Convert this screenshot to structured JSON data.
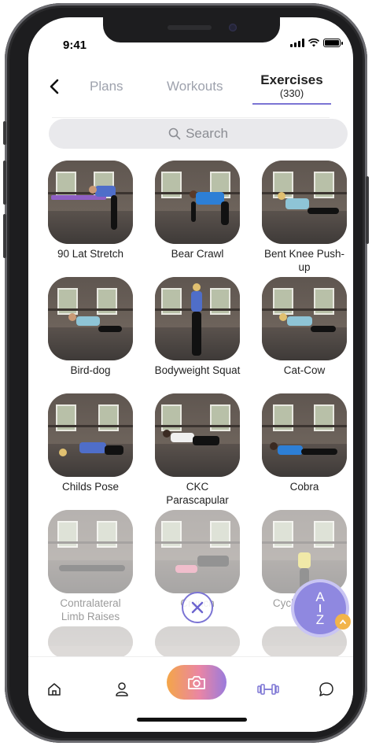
{
  "status": {
    "time": "9:41"
  },
  "nav": {
    "tabs": [
      {
        "label": "Plans"
      },
      {
        "label": "Workouts"
      },
      {
        "label": "Exercises",
        "count": "(330)",
        "active": true
      }
    ]
  },
  "search": {
    "placeholder": "Search"
  },
  "exercises": [
    {
      "label": "90 Lat Stretch"
    },
    {
      "label": "Bear Crawl"
    },
    {
      "label": "Bent Knee Push-up"
    },
    {
      "label": "Bird-dog"
    },
    {
      "label": "Bodyweight Squat"
    },
    {
      "label": "Cat-Cow"
    },
    {
      "label": "Childs Pose"
    },
    {
      "label": "CKC Parascapular"
    },
    {
      "label": "Cobra"
    },
    {
      "label": "Contralateral Limb Raises"
    },
    {
      "label": "Crunch"
    },
    {
      "label": "Cycled Squat"
    }
  ],
  "sort_button": {
    "top": "A",
    "bottom": "Z"
  },
  "icons": {
    "back": "chevron-left-icon",
    "search": "magnifier-icon",
    "close": "close-circle-icon",
    "sort": "az-sort-icon",
    "home": "home-icon",
    "profile": "person-icon",
    "camera": "camera-icon",
    "exercises": "dumbbell-icon",
    "chat": "chat-bubble-icon"
  },
  "colors": {
    "accent": "#7b74d4",
    "sort_bg": "#8f88e0",
    "chevron": "#f2b44a"
  }
}
